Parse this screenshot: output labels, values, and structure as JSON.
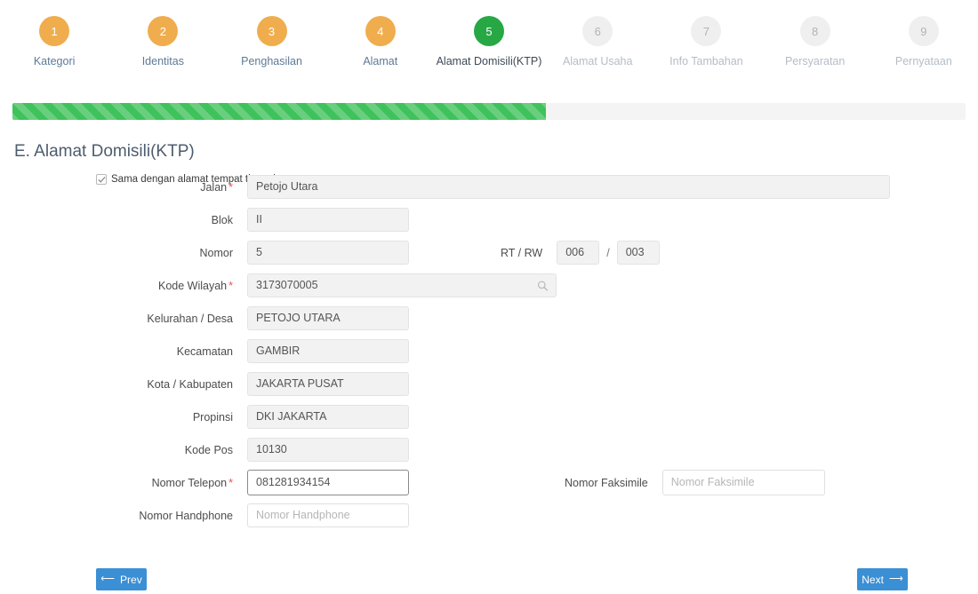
{
  "stepper": {
    "steps": [
      {
        "number": "1",
        "label": "Kategori",
        "state": "done"
      },
      {
        "number": "2",
        "label": "Identitas",
        "state": "done"
      },
      {
        "number": "3",
        "label": "Penghasilan",
        "state": "done"
      },
      {
        "number": "4",
        "label": "Alamat",
        "state": "done"
      },
      {
        "number": "5",
        "label": "Alamat Domisili(KTP)",
        "state": "active"
      },
      {
        "number": "6",
        "label": "Alamat Usaha",
        "state": "todo"
      },
      {
        "number": "7",
        "label": "Info Tambahan",
        "state": "todo"
      },
      {
        "number": "8",
        "label": "Persyaratan",
        "state": "todo"
      },
      {
        "number": "9",
        "label": "Pernyataan",
        "state": "todo"
      }
    ]
  },
  "progress": {
    "percent": 56,
    "fill_color": "#3fc25b",
    "track_color": "#f4f4f4"
  },
  "section": {
    "title": "E. Alamat Domisili(KTP)"
  },
  "same_address": {
    "label": "Sama dengan alamat tempat tinggal",
    "checked": true
  },
  "form": {
    "jalan": {
      "label": "Jalan",
      "required": "*",
      "value": "Petojo Utara"
    },
    "blok": {
      "label": "Blok",
      "value": "II"
    },
    "nomor": {
      "label": "Nomor",
      "value": "5"
    },
    "rtrw": {
      "label": "RT / RW",
      "rt": "006",
      "separator": "/",
      "rw": "003"
    },
    "kode_wilayah": {
      "label": "Kode Wilayah",
      "required": "*",
      "value": "3173070005",
      "icon": "search-icon"
    },
    "kelurahan": {
      "label": "Kelurahan / Desa",
      "value": "PETOJO UTARA"
    },
    "kecamatan": {
      "label": "Kecamatan",
      "value": "GAMBIR"
    },
    "kota": {
      "label": "Kota / Kabupaten",
      "value": "JAKARTA PUSAT"
    },
    "propinsi": {
      "label": "Propinsi",
      "value": "DKI JAKARTA"
    },
    "kode_pos": {
      "label": "Kode Pos",
      "value": "10130"
    },
    "telepon": {
      "label": "Nomor Telepon",
      "required": "*",
      "value": "081281934154"
    },
    "faksimile": {
      "label": "Nomor Faksimile",
      "placeholder": "Nomor Faksimile",
      "value": ""
    },
    "handphone": {
      "label": "Nomor Handphone",
      "placeholder": "Nomor Handphone",
      "value": ""
    }
  },
  "buttons": {
    "prev": "Prev",
    "next": "Next",
    "color": "#3b8fd4"
  }
}
